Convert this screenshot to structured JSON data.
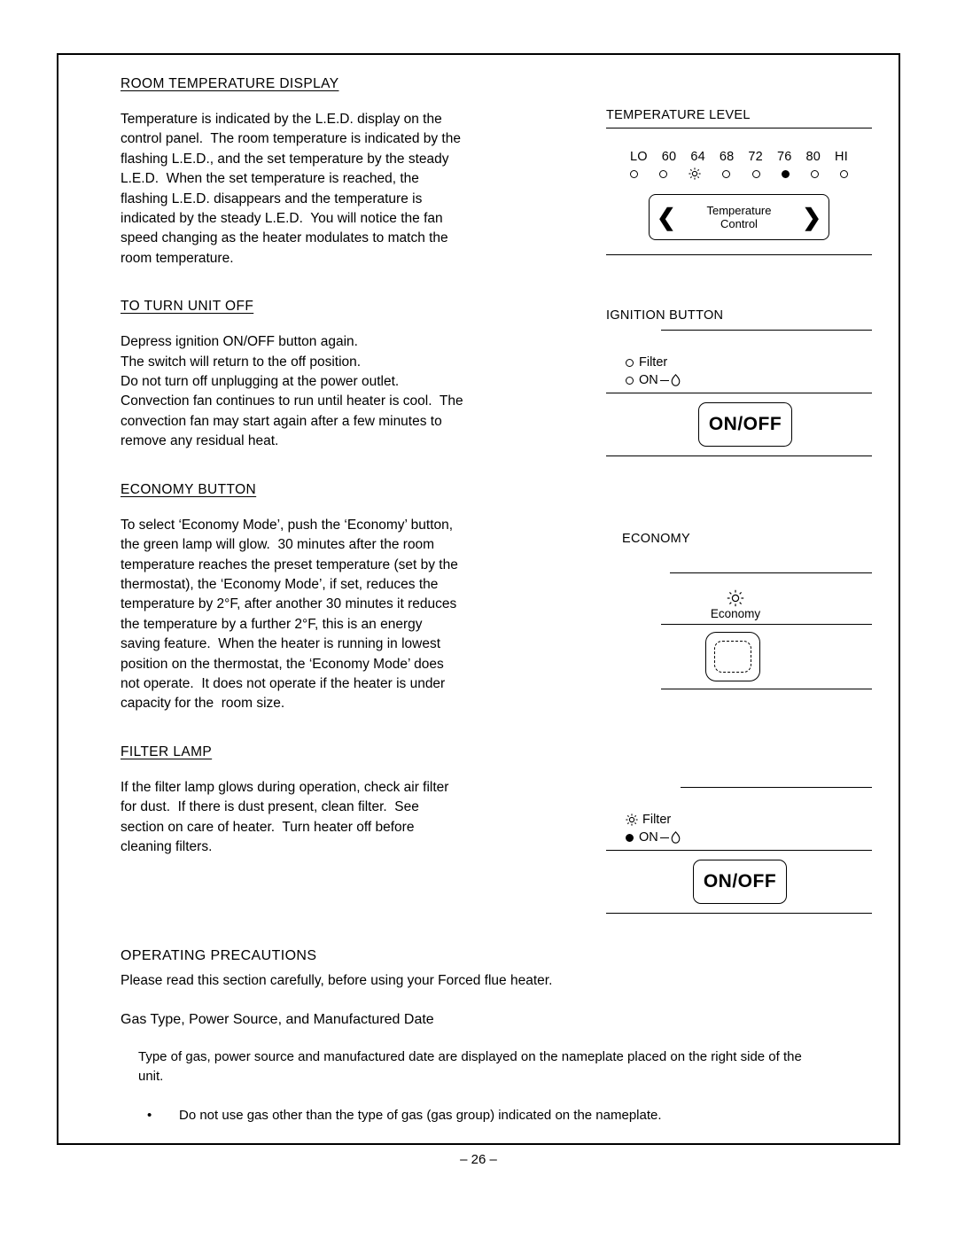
{
  "document": {
    "page_number": "– 26 –"
  },
  "sections": [
    {
      "heading": "ROOM TEMPERATURE DISPLAY",
      "body": "Temperature is indicated by the L.E.D. display on the\ncontrol panel.  The room temperature is indicated by the\nflashing L.E.D., and the set temperature by the steady\nL.E.D.  When the set temperature is reached, the\nflashing L.E.D. disappears and the temperature is\nindicated by the steady L.E.D.  You will notice the fan\nspeed changing as the heater modulates to match the\nroom temperature."
    },
    {
      "heading": "TO TURN UNIT OFF",
      "body": "Depress ignition ON/OFF button again.\nThe switch will return to the off position.\nDo not turn off unplugging at the power outlet.\nConvection fan continues to run until heater is cool.  The\nconvection fan may start again after a few minutes to\nremove any residual heat."
    },
    {
      "heading": "ECONOMY BUTTON",
      "body": "To select ‘Economy Mode’, push the ‘Economy’ button,\nthe green lamp will glow.  30 minutes after the room\ntemperature reaches the preset temperature (set by the\nthermostat), the ‘Economy Mode’, if set, reduces the\ntemperature by 2°F, after another 30 minutes it reduces\nthe temperature by a further 2°F, this is an energy\nsaving feature.  When the heater is running in lowest\nposition on the thermostat, the ‘Economy Mode’ does\nnot operate.  It does not operate if the heater is under\ncapacity for the  room size."
    },
    {
      "heading": "FILTER LAMP",
      "body": "If the filter lamp glows during operation, check air filter\nfor dust.  If there is dust present, clean filter.  See\nsection on care of heater.  Turn heater off before\ncleaning filters."
    }
  ],
  "panels": {
    "temperature": {
      "title": "TEMPERATURE LEVEL",
      "scale_labels": [
        "LO",
        "60",
        "64",
        "68",
        "72",
        "76",
        "80",
        "HI"
      ],
      "led_states": [
        "off",
        "off",
        "flashing",
        "off",
        "off",
        "on",
        "off",
        "off"
      ],
      "control_label_line1": "Temperature",
      "control_label_line2": "Control",
      "arrow_left": "❮",
      "arrow_right": "❯"
    },
    "ignition": {
      "title": "IGNITION BUTTON",
      "filter_label": "Filter",
      "on_label": "ON",
      "filter_state": "off",
      "on_state": "off",
      "button_label": "ON/OFF"
    },
    "economy": {
      "title": "ECONOMY",
      "label": "Economy"
    },
    "filter_lamp": {
      "filter_label": "Filter",
      "on_label": "ON",
      "filter_state": "glowing",
      "on_state": "on",
      "button_label": "ON/OFF"
    }
  },
  "bottom": {
    "heading": "OPERATING PRECAUTIONS",
    "intro": "Please read this section carefully, before using your Forced flue heater.",
    "subheading": "Gas Type, Power Source, and Manufactured Date",
    "paragraph": "Type of gas, power source and manufactured date are displayed on the nameplate placed on the right side of the unit.",
    "bullet_mark": "•",
    "bullet": "Do not use gas other than the type of gas (gas group) indicated on the nameplate."
  }
}
